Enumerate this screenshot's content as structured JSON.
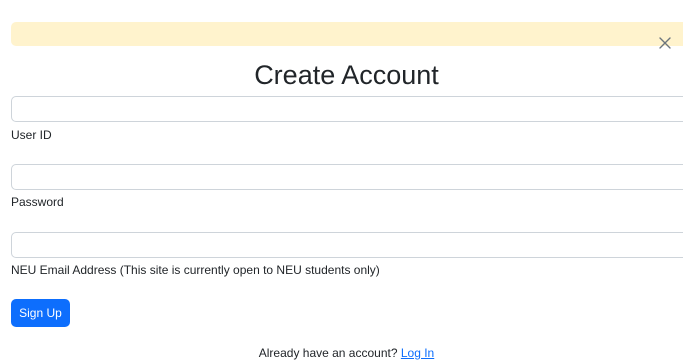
{
  "alert": {
    "close_icon": "close-icon"
  },
  "header": {
    "title": "Create Account"
  },
  "form": {
    "user_id": {
      "label": "User ID",
      "value": "",
      "placeholder": ""
    },
    "password": {
      "label": "Password",
      "value": "",
      "placeholder": ""
    },
    "email": {
      "label": "NEU Email Address (This site is currently open to NEU students only)",
      "value": "",
      "placeholder": ""
    },
    "submit_label": "Sign Up"
  },
  "footer": {
    "prompt": "Already have an account?",
    "login_link": "Log In"
  },
  "colors": {
    "alert_bg": "#fff3cd",
    "primary": "#0d6efd",
    "input_border": "#ced4da",
    "text": "#212529"
  }
}
